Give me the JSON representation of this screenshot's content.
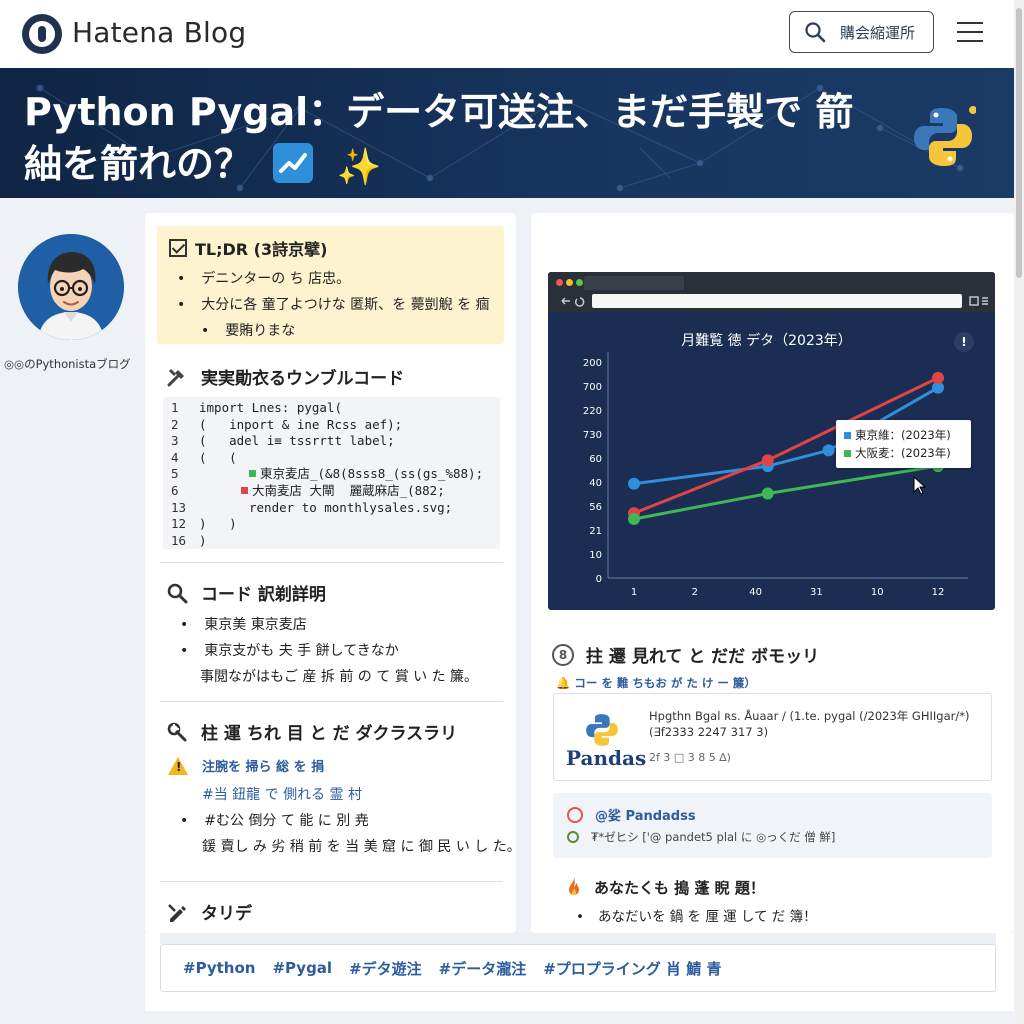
{
  "header": {
    "logo_text": "Hatena Blog",
    "search_label": "購会縮運所"
  },
  "banner": {
    "title": "Python Pygal：データ可送注、まだ手製で 箭紬を箭れの？",
    "sparkle": "✨"
  },
  "author": {
    "name": "◎◎のPythonistaブログ"
  },
  "tldr": {
    "heading": "TL;DR (3詩京擘)",
    "items": [
      "デニンターの ち 店忠。",
      "大分に各 童了よつけな 匿斯、を 薨剴觬 を 痼",
      "要賄りまな"
    ]
  },
  "sample_code": {
    "title": "実実勛衣るウンブルコード",
    "lines": [
      {
        "num": "1",
        "text": "import Lnes: pygal("
      },
      {
        "num": "2",
        "text": "(   inport & ine Rcss aef);"
      },
      {
        "num": "3",
        "text": "(   adel i≡ tssrrtt label;"
      },
      {
        "num": "4",
        "text": "(   ("
      },
      {
        "num": "5",
        "text": "東京麦店_(&8(8sss8_(ss(gs_%88);"
      },
      {
        "num": "6",
        "text": "大南麦店 大閘  麗蔵麻店_(882;"
      },
      {
        "num": "13",
        "text": "render to monthlysales.svg;"
      },
      {
        "num": "12",
        "text": ")   )"
      },
      {
        "num": "16",
        "text": ")"
      }
    ]
  },
  "code_explain": {
    "title": "コード 訳剃詳明",
    "items": [
      "東京美 東京麦店",
      "東京支がも 夫 手 餅してきなか",
      "事閲ながはもご 産 拆 前 の て 賞 い た 簾。"
    ]
  },
  "pitfalls": {
    "title": "柱 運 ちれ 目 と だ ダクラスラリ",
    "warning": "注腕を 掃ら 総 を 捐",
    "items": [
      "#当 鈕龍 で 側れる 霊 村",
      "#む公 倒分 て 能 に 別 尭",
      "鍰 賣し み 劣 稍 前 を 当 美 窟 に 御 民 い し た。"
    ]
  },
  "summary": {
    "title": "タリデ"
  },
  "chart_window": {
    "title": "月難覧 徳 デタ（2023年）",
    "info_icon": "!",
    "tooltip_items": [
      "東京維：(2023年)",
      "大阪麦：(2023年)"
    ]
  },
  "chart_data": {
    "type": "line",
    "title": "月難覧 徳 デタ（2023年）",
    "x_tick_labels": [
      "1",
      "2",
      "40",
      "31",
      "10",
      "12"
    ],
    "y_tick_labels": [
      "0",
      "10",
      "21",
      "56",
      "40",
      "60",
      "730",
      "220",
      "700",
      "200"
    ],
    "series": [
      {
        "name": "東京維：(2023年)",
        "color": "#2f8fdc",
        "points": [
          [
            1,
            43
          ],
          [
            3.2,
            52
          ],
          [
            4.2,
            60
          ],
          [
            6,
            92
          ]
        ]
      },
      {
        "name": "大阪麦：(2023年)",
        "color": "#e04545",
        "points": [
          [
            1,
            28
          ],
          [
            3.2,
            55
          ],
          [
            6,
            97
          ]
        ]
      },
      {
        "name": "",
        "color": "#3fb756",
        "points": [
          [
            1,
            25
          ],
          [
            3.2,
            38
          ],
          [
            6,
            52
          ]
        ]
      }
    ]
  },
  "related": {
    "title": "拄 遷 見れて と だだ ボモッリ",
    "subtitle": "🔔 コー を 難 ちもお が た け ー 簾）",
    "card": {
      "logo_word": "Pandas",
      "line1": "Hpgthn Bgal ʀs. Åuaar / (1.te. pygal (/2023年  GHIIgar/*)",
      "line2": "(∃f2333  2247 317 3)",
      "line3": "2f 3 □ 3 8 5 ∆)"
    },
    "card2": {
      "title": "@娑 Pandadss",
      "text": "₮*ゼヒシ ['@ pandet5 plal に ◎っくだ 僧 鮮]"
    }
  },
  "cta": {
    "title": "あなたくも 搗 蓬 睨 題！",
    "text": "あなだいを 鍋 を 厘 運 して だ 簿！"
  },
  "tags": [
    "#Python",
    "#Pygal",
    "#デタ遊注",
    "#データ瀧注",
    "#プロプライング 肖 鯖 青"
  ],
  "colors": {
    "banner_bg": "#0f2544",
    "link_blue": "#2d5d9e",
    "tldr_bg": "#fdf3cf"
  }
}
